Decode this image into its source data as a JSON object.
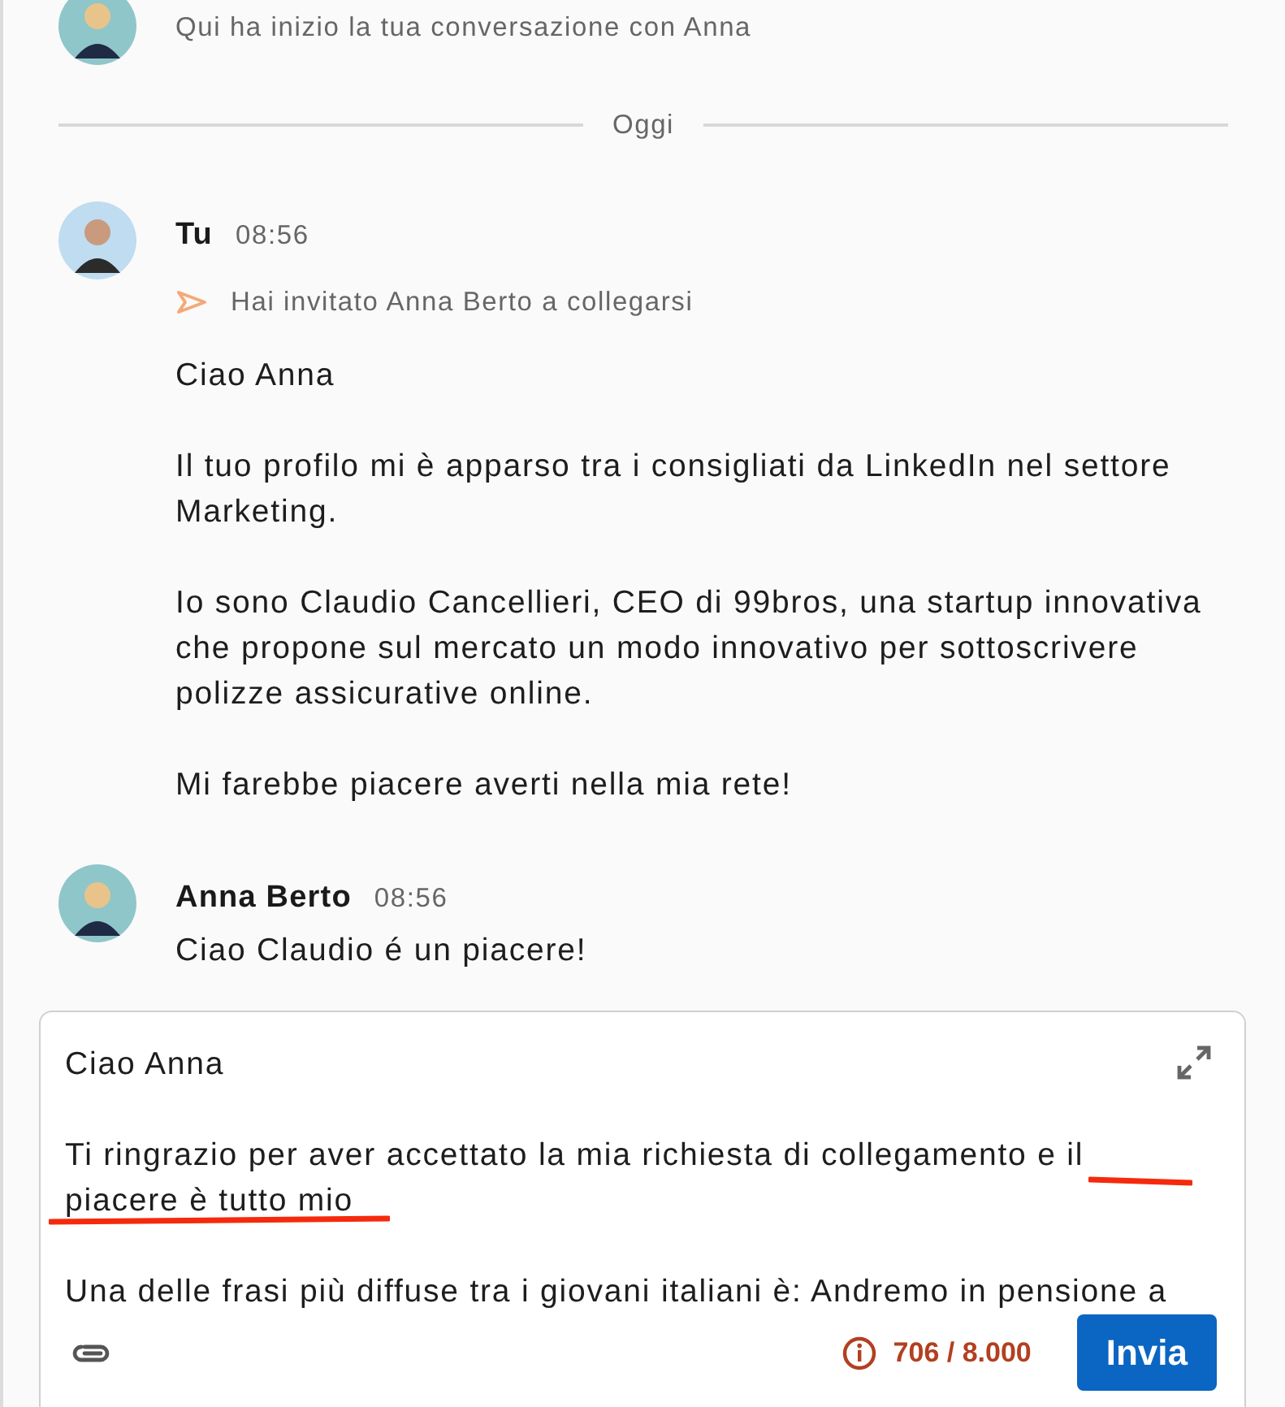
{
  "intro": {
    "text": "Qui ha inizio la tua conversazione con Anna"
  },
  "divider": {
    "label": "Oggi"
  },
  "messages": [
    {
      "kind": "self",
      "sender": "Tu",
      "time": "08:56",
      "event": "Hai invitato Anna Berto a collegarsi",
      "paragraphs": [
        "Ciao Anna",
        "Il tuo profilo mi è apparso tra i consigliati da LinkedIn nel settore Marketing.",
        "Io sono Claudio Cancellieri, CEO di 99bros, una startup innovativa che propone sul mercato un modo innovativo per sottoscrivere polizze assicurative online.",
        "Mi farebbe piacere averti nella mia rete!"
      ]
    },
    {
      "kind": "contact",
      "sender": "Anna Berto",
      "time": "08:56",
      "paragraphs": [
        "Ciao Claudio é un piacere!"
      ]
    }
  ],
  "composer": {
    "paragraphs": [
      "Ciao Anna",
      "Ti ringrazio per aver accettato la mia richiesta di collegamento e il piacere è tutto mio",
      "Una delle frasi più diffuse tra i giovani italiani è: Andremo in pensione a"
    ],
    "annotation_underlines": true,
    "counter": "706 / 8.000",
    "send_label": "Invia"
  }
}
